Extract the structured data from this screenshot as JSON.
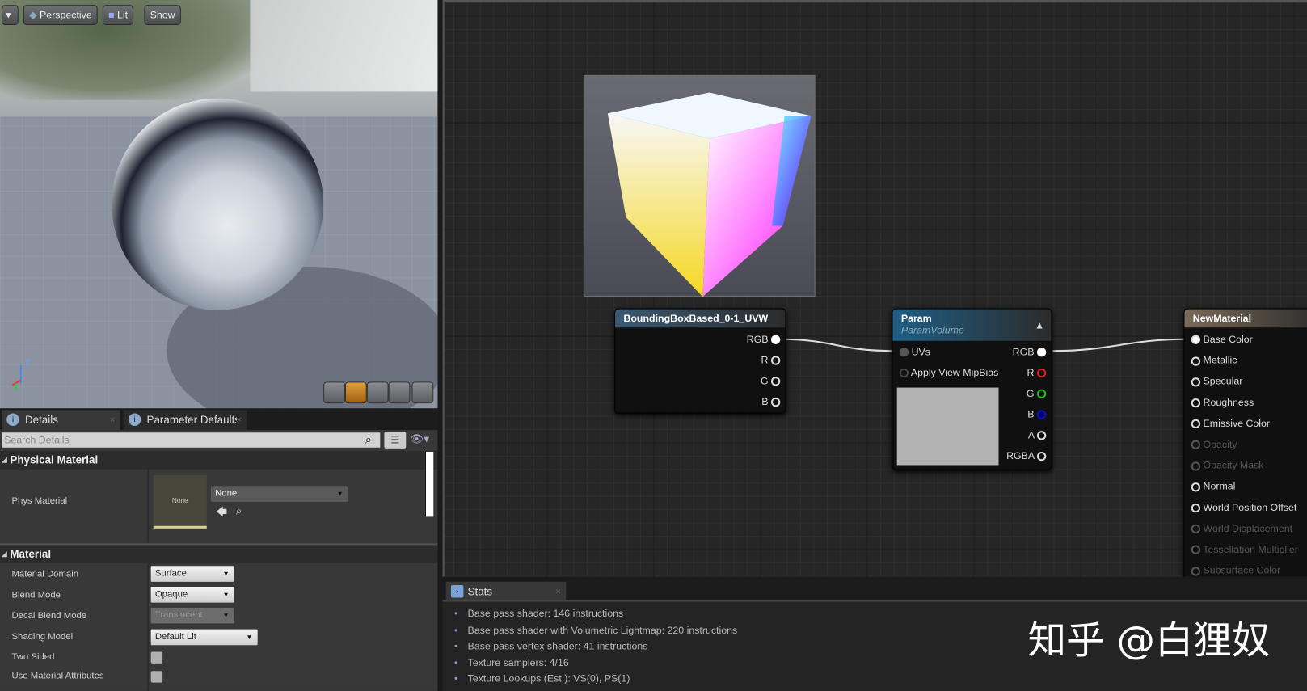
{
  "viewport": {
    "menu_label": "▾",
    "perspective": "Perspective",
    "lit": "Lit",
    "show": "Show",
    "axis_z": "Z"
  },
  "details": {
    "tabs": [
      {
        "label": "Details",
        "close": "×"
      },
      {
        "label": "Parameter Defaults",
        "close": "×"
      }
    ],
    "search_placeholder": "Search Details",
    "physical_section": "Physical Material",
    "phys_label": "Phys Material",
    "phys_thumb": "None",
    "phys_value": "None",
    "material_section": "Material",
    "rows": [
      {
        "label": "Material Domain",
        "value": "Surface"
      },
      {
        "label": "Blend Mode",
        "value": "Opaque"
      },
      {
        "label": "Decal Blend Mode",
        "value": "Translucent"
      },
      {
        "label": "Shading Model",
        "value": "Default Lit"
      },
      {
        "label": "Two Sided"
      },
      {
        "label": "Use Material Attributes"
      }
    ]
  },
  "graph": {
    "bbox_node": {
      "title": "BoundingBoxBased_0-1_UVW",
      "pins": [
        "RGB",
        "R",
        "G",
        "B"
      ]
    },
    "param_node": {
      "title": "Param",
      "subtitle": "ParamVolume",
      "inputs": [
        "UVs",
        "Apply View MipBias"
      ],
      "outputs": [
        "RGB",
        "R",
        "G",
        "B",
        "A",
        "RGBA"
      ]
    },
    "material_node": {
      "title": "NewMaterial",
      "inputs": [
        {
          "label": "Base Color",
          "enabled": true
        },
        {
          "label": "Metallic",
          "enabled": true
        },
        {
          "label": "Specular",
          "enabled": true
        },
        {
          "label": "Roughness",
          "enabled": true
        },
        {
          "label": "Emissive Color",
          "enabled": true
        },
        {
          "label": "Opacity",
          "enabled": false
        },
        {
          "label": "Opacity Mask",
          "enabled": false
        },
        {
          "label": "Normal",
          "enabled": true
        },
        {
          "label": "World Position Offset",
          "enabled": true
        },
        {
          "label": "World Displacement",
          "enabled": false
        },
        {
          "label": "Tessellation Multiplier",
          "enabled": false
        },
        {
          "label": "Subsurface Color",
          "enabled": false
        }
      ]
    }
  },
  "stats": {
    "tab": "Stats",
    "close": "×",
    "lines": [
      "Base pass shader: 146 instructions",
      "Base pass shader with Volumetric Lightmap: 220 instructions",
      "Base pass vertex shader: 41 instructions",
      "Texture samplers: 4/16",
      "Texture Lookups (Est.): VS(0), PS(1)"
    ]
  },
  "watermark": "知乎 @白狸奴",
  "colors": {
    "param_header": "#1f5f86",
    "material_header": "#7a6a58",
    "pin_r": "#e02020",
    "pin_g": "#20c020",
    "pin_b": "#1010c0"
  }
}
